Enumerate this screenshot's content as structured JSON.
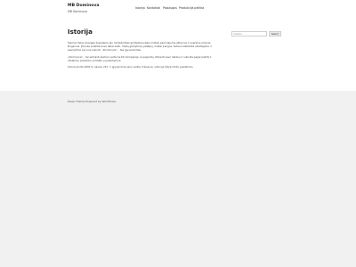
{
  "header": {
    "site_title": "MB Dominova",
    "site_description": "MB Dominova",
    "nav": [
      "Istorija",
      "Kontaktai",
      "Paslaugos",
      "Produkcija pelitka"
    ]
  },
  "main": {
    "title": "Istorija",
    "paragraphs": [
      "Šiemet mūsų draugija švęsdama jau dvidešimties gimtadienį-šiais metais paminėjome aktyvius ir svarbius įmonės žingsnius. Įmonės pradžia buvo labai kukli, mažų gamybinių patalpų, mažai įrangos, tačiau nestokota užsidegimo ir pasiryžimo ką nors sukurti. „Dominova“ – tas įgyvendintas.",
      "„Dominova“ – tai skirianti šeimos vertę turinti kompanija, iš pagrindų dirbanti savo darbus ir sukurta pagal patirtį ir užsakovų poreikius, pristato jų pasiūlymus.",
      "Įmonė įkurta 2001m. sausio 21d. ir įgyvendina savo veiklą rinkoje su viduryje išbrandintų pasiekimų."
    ]
  },
  "sidebar": {
    "search_placeholder": "Paieška...",
    "search_button": "Search"
  },
  "footer": {
    "text": "Deep Theme Powered by WordPress"
  }
}
